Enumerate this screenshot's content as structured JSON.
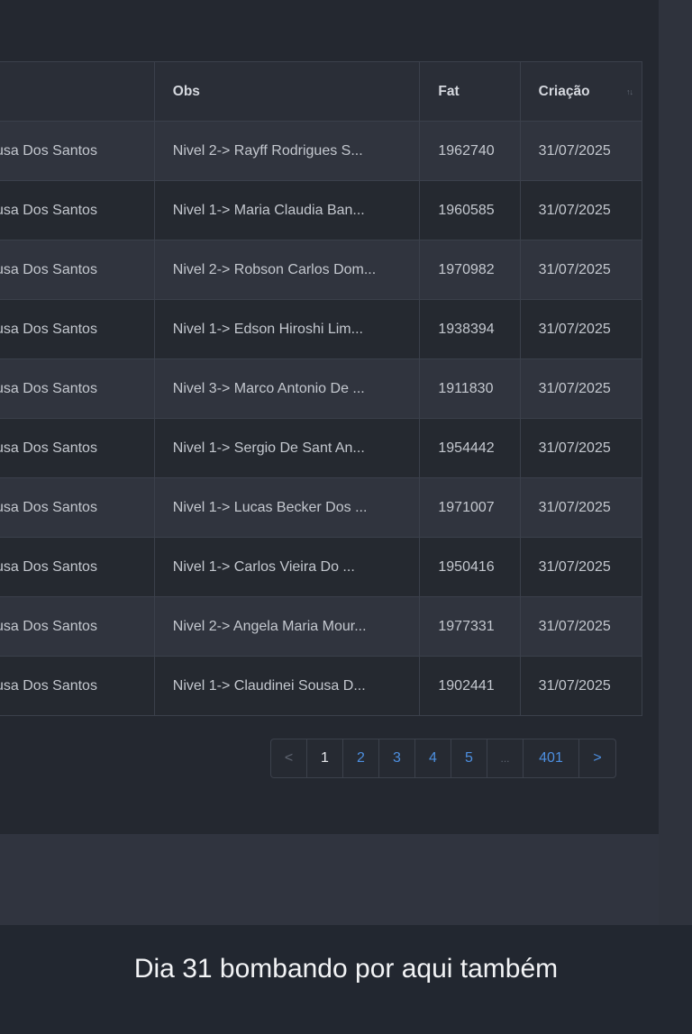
{
  "table": {
    "headers": {
      "name": "",
      "obs": "Obs",
      "fat": "Fat",
      "date": "Criação"
    },
    "sort_icon": "↑↓",
    "rows": [
      {
        "name": "usa Dos Santos",
        "obs": "Nivel 2-> Rayff Rodrigues S...",
        "fat": "1962740",
        "date": "31/07/2025"
      },
      {
        "name": "usa Dos Santos",
        "obs": "Nivel 1-> Maria Claudia Ban...",
        "fat": "1960585",
        "date": "31/07/2025"
      },
      {
        "name": "usa Dos Santos",
        "obs": "Nivel 2-> Robson Carlos Dom...",
        "fat": "1970982",
        "date": "31/07/2025"
      },
      {
        "name": "usa Dos Santos",
        "obs": "Nivel 1-> Edson Hiroshi Lim...",
        "fat": "1938394",
        "date": "31/07/2025"
      },
      {
        "name": "usa Dos Santos",
        "obs": "Nivel 3-> Marco Antonio De ...",
        "fat": "1911830",
        "date": "31/07/2025"
      },
      {
        "name": "usa Dos Santos",
        "obs": "Nivel 1-> Sergio De Sant An...",
        "fat": "1954442",
        "date": "31/07/2025"
      },
      {
        "name": "usa Dos Santos",
        "obs": "Nivel 1-> Lucas Becker Dos ...",
        "fat": "1971007",
        "date": "31/07/2025"
      },
      {
        "name": "usa Dos Santos",
        "obs": "Nivel 1-> Carlos Vieira Do ...",
        "fat": "1950416",
        "date": "31/07/2025"
      },
      {
        "name": "usa Dos Santos",
        "obs": "Nivel 2-> Angela Maria Mour...",
        "fat": "1977331",
        "date": "31/07/2025"
      },
      {
        "name": "usa Dos Santos",
        "obs": "Nivel 1-> Claudinei Sousa D...",
        "fat": "1902441",
        "date": "31/07/2025"
      }
    ]
  },
  "pagination": {
    "prev": "<",
    "pages": [
      "1",
      "2",
      "3",
      "4",
      "5"
    ],
    "ellipsis": "...",
    "last": "401",
    "next": ">",
    "current": "1"
  },
  "caption": "Dia 31 bombando por aqui também"
}
